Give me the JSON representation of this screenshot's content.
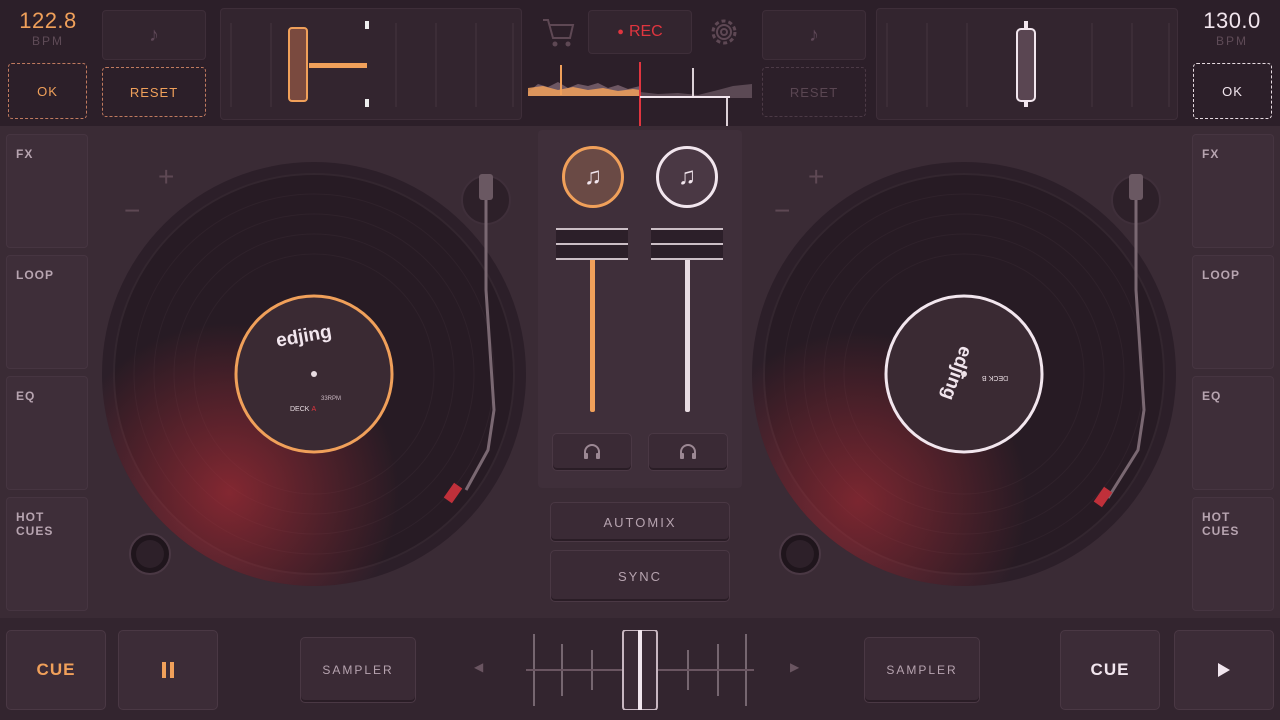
{
  "deck_a": {
    "bpm": "122.8",
    "bpm_label": "BPM",
    "ok_label": "OK",
    "reset_label": "RESET",
    "accent": "#f0a05a",
    "label_brand": "edjing",
    "label_deck": "DECK",
    "label_deck_letter": "A",
    "label_speed": "33RPM"
  },
  "deck_b": {
    "bpm": "130.0",
    "bpm_label": "BPM",
    "ok_label": "OK",
    "reset_label": "RESET",
    "accent": "#f2e6ee",
    "label_brand": "edjing",
    "label_deck": "DECK",
    "label_deck_letter": "B"
  },
  "header": {
    "rec_label": "REC",
    "rec_color": "#e0353f",
    "cart_icon": "cart-icon",
    "settings_icon": "gear-icon"
  },
  "left_side": {
    "items": [
      "FX",
      "LOOP",
      "EQ",
      "HOT\nCUES"
    ]
  },
  "right_side": {
    "items": [
      "FX",
      "LOOP",
      "EQ",
      "HOT\nCUES"
    ]
  },
  "mixer": {
    "automix_label": "AUTOMIX",
    "sync_label": "SYNC",
    "volume_a": 0.9,
    "volume_b": 0.9,
    "crossfader": 0.5
  },
  "bottom": {
    "cue_a": "CUE",
    "cue_b": "CUE",
    "sampler_a": "SAMPLER",
    "sampler_b": "SAMPLER",
    "play_a_state": "pause",
    "play_b_state": "play"
  }
}
